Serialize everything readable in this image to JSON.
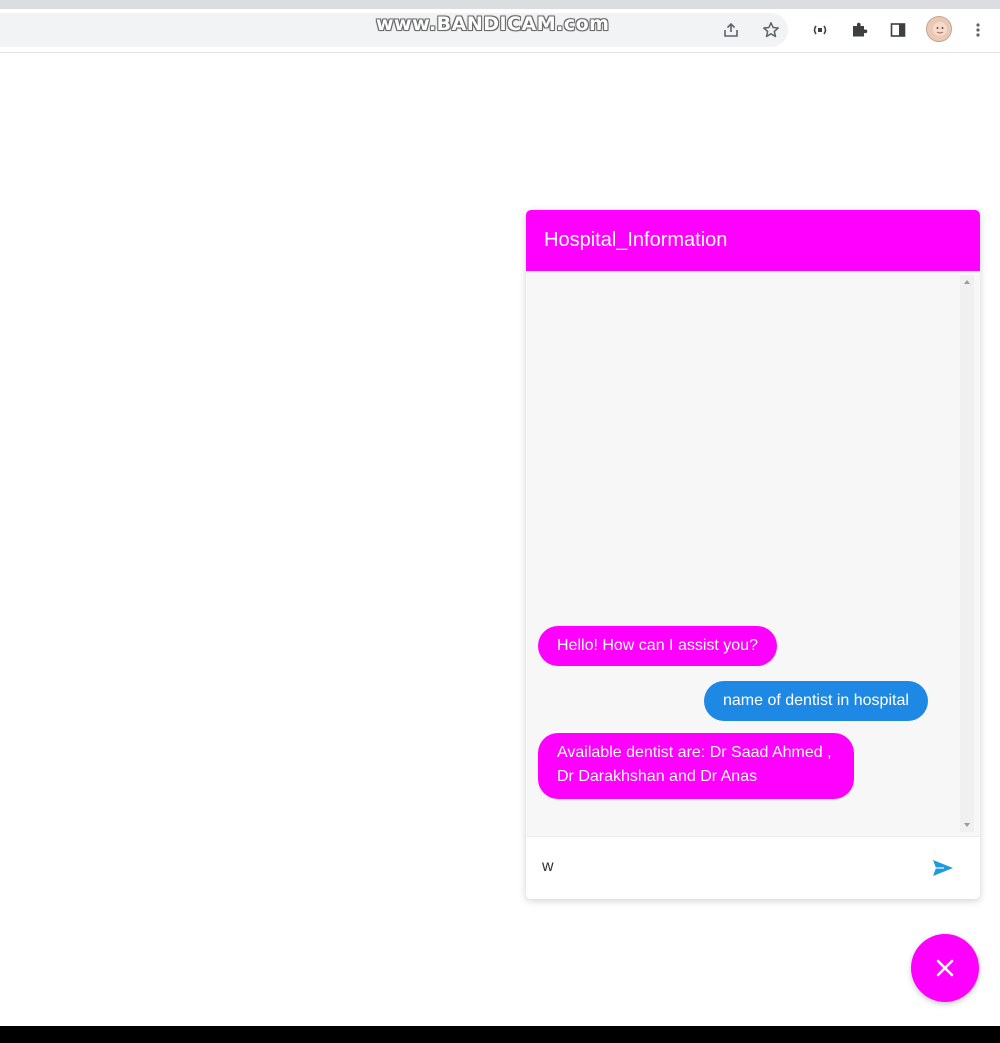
{
  "watermark": {
    "text": "www.BANDICAM.com"
  },
  "toolbar": {
    "icons": [
      "share-icon",
      "star-icon",
      "extension-cast-icon",
      "puzzle-icon",
      "side-panel-icon",
      "avatar",
      "more-vert-icon"
    ]
  },
  "chat": {
    "title": "Hospital_Information",
    "messages": [
      {
        "sender": "bot",
        "text": "Hello! How can I assist you?"
      },
      {
        "sender": "user",
        "text": "name of dentist in hospital"
      },
      {
        "sender": "bot",
        "text": "Available dentist are: Dr Saad Ahmed , Dr Darakhshan and Dr Anas"
      }
    ],
    "input": {
      "value": "w",
      "placeholder": ""
    },
    "send_icon": "send-icon"
  },
  "fab": {
    "icon": "close-icon"
  },
  "colors": {
    "primary": "#ff00ff",
    "user_bubble": "#1e88e5",
    "send_icon": "#1e9be0"
  }
}
